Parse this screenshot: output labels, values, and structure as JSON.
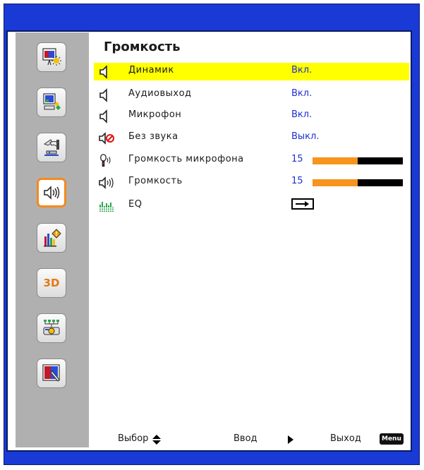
{
  "title": "Громкость",
  "sidebar": {
    "items": [
      {
        "name": "picture",
        "icon": "picture-settings-icon",
        "active": false
      },
      {
        "name": "display",
        "icon": "display-settings-icon",
        "active": false
      },
      {
        "name": "setup",
        "icon": "setup-icon",
        "active": false
      },
      {
        "name": "volume",
        "icon": "volume-icon",
        "active": true
      },
      {
        "name": "options",
        "icon": "options-icon",
        "active": false
      },
      {
        "name": "3d",
        "icon": "3d-icon",
        "label": "3D",
        "active": false
      },
      {
        "name": "network",
        "icon": "network-icon",
        "active": false
      },
      {
        "name": "interactive",
        "icon": "interactive-icon",
        "active": false
      }
    ]
  },
  "rows": [
    {
      "label": "Динамик",
      "value": "Вкл.",
      "icon": "speaker-icon",
      "selected": true
    },
    {
      "label": "Аудиовыход",
      "value": "Вкл.",
      "icon": "speaker-icon",
      "selected": false
    },
    {
      "label": "Микрофон",
      "value": "Вкл.",
      "icon": "speaker-icon",
      "selected": false
    },
    {
      "label": "Без звука",
      "value": "Выкл.",
      "icon": "mute-icon",
      "selected": false
    },
    {
      "label": "Громкость микрофона",
      "value": "15",
      "level": 0.5,
      "icon": "microphone-volume-icon",
      "selected": false
    },
    {
      "label": "Громкость",
      "value": "15",
      "level": 0.5,
      "icon": "volume-icon",
      "selected": false
    },
    {
      "label": "EQ",
      "value": "",
      "icon": "equalizer-icon",
      "selected": false
    }
  ],
  "footer": {
    "select_label": "Выбор",
    "enter_label": "Ввод",
    "exit_label": "Выход",
    "menu_badge": "Menu"
  },
  "colors": {
    "frame": "#1a3ad6",
    "selection": "#ffff00",
    "value_text": "#1f2fd0",
    "bar_fill": "#f7941d",
    "active_border": "#f48a1e"
  }
}
